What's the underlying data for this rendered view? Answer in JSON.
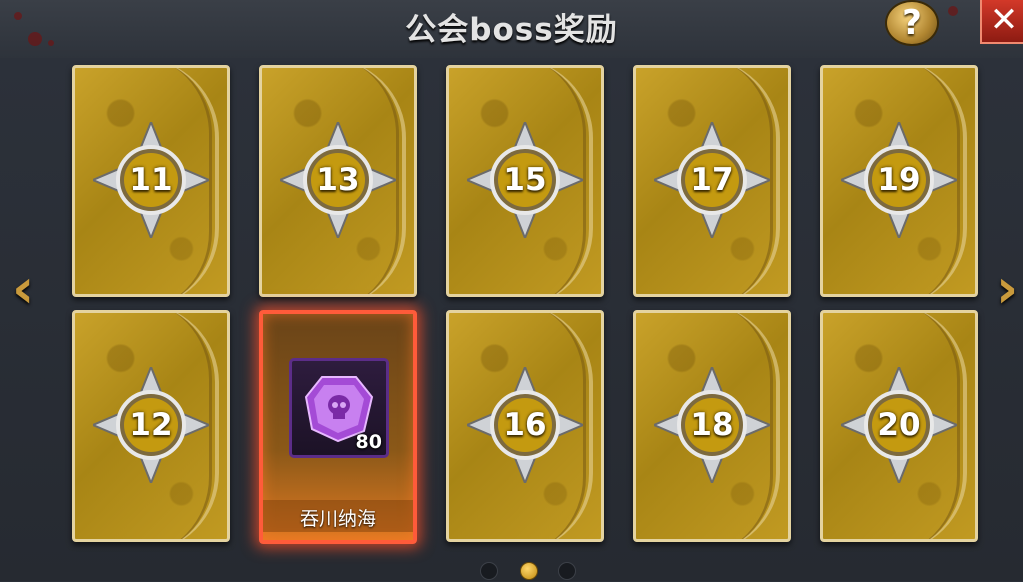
{
  "header": {
    "title": "公会boss奖励",
    "help_label": "?",
    "close_label": "✕"
  },
  "nav": {
    "prev_label": "‹",
    "next_label": "›"
  },
  "cards": [
    {
      "rank": "11"
    },
    {
      "rank": "13"
    },
    {
      "rank": "15"
    },
    {
      "rank": "17"
    },
    {
      "rank": "19"
    },
    {
      "rank": "12"
    },
    {
      "revealed": true,
      "item": "purple-skull-gem",
      "quantity": "80",
      "owner": "吞川纳海"
    },
    {
      "rank": "16"
    },
    {
      "rank": "18"
    },
    {
      "rank": "20"
    }
  ],
  "pagination": {
    "pages": 3,
    "active": 2
  },
  "colors": {
    "accent": "#c99a3c",
    "card_gold": "#b8921e",
    "highlight": "#ff5b3a"
  }
}
